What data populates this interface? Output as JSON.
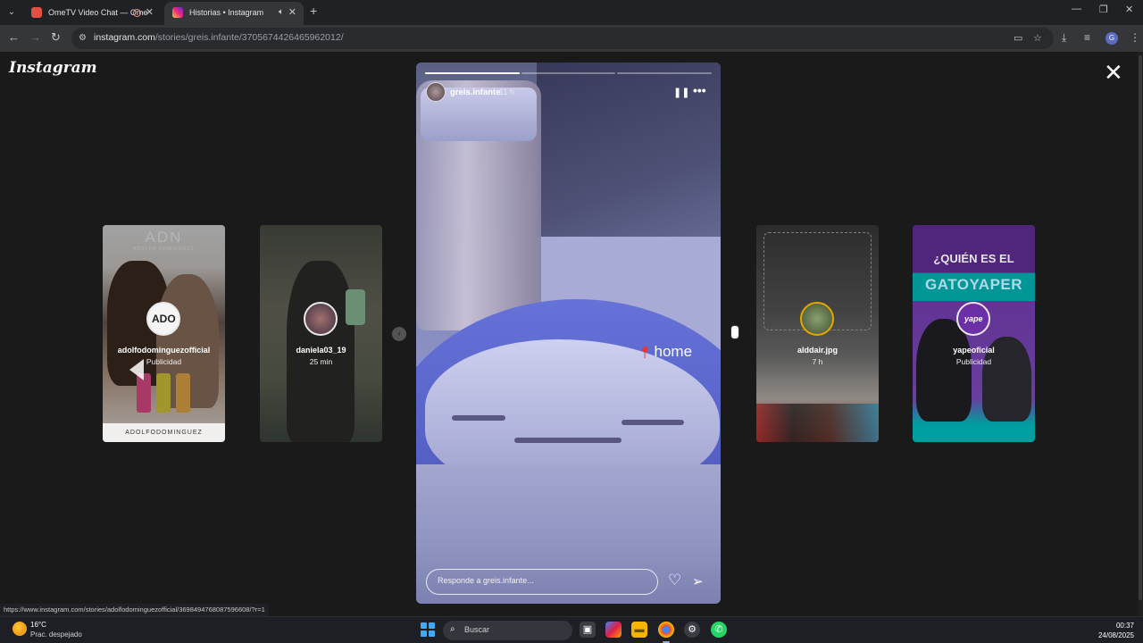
{
  "browser": {
    "tabs": [
      {
        "title": "OmeTV Video Chat — Ome"
      },
      {
        "title": "Historias • Instagram"
      }
    ],
    "url_domain": "instagram.com",
    "url_path": "/stories/greis.infante/3705674426465962012/"
  },
  "page": {
    "logo": "Instagram"
  },
  "main_story": {
    "username": "greis.infante",
    "time": "11 h",
    "location_sticker": "home",
    "reply_placeholder": "Responde a greis.infante...",
    "progress": [
      1.0,
      0.0,
      0.0
    ]
  },
  "side_stories": [
    {
      "username": "adolfodominguezofficial",
      "subtitle": "Publicidad",
      "brand": "ADN",
      "brand_tagline": "ADOLFO DOMINGUEZ",
      "footer": "ADOLFODOMINGUEZ",
      "avatar_text": "ADO"
    },
    {
      "username": "daniela03_19",
      "subtitle": "25 min"
    },
    {
      "username": "alddair.jpg",
      "subtitle": "7 h"
    },
    {
      "username": "yapeoficial",
      "subtitle": "Publicidad",
      "headline1": "¿QUIÉN ES EL",
      "headline2": "GATOYAPER",
      "avatar_text": "yape"
    }
  ],
  "status_bar_url": "https://www.instagram.com/stories/adolfodominguezofficial/3698494768087596608/?r=1",
  "taskbar": {
    "temperature": "16°C",
    "condition": "Prac. despejado",
    "search_label": "Buscar",
    "time": "00:37",
    "date": "24/08/2025"
  },
  "colors": {
    "page_background": "#1a1a1a",
    "instagram_accent": "#ee2a7b",
    "yape_purple": "#6b2fa8"
  }
}
